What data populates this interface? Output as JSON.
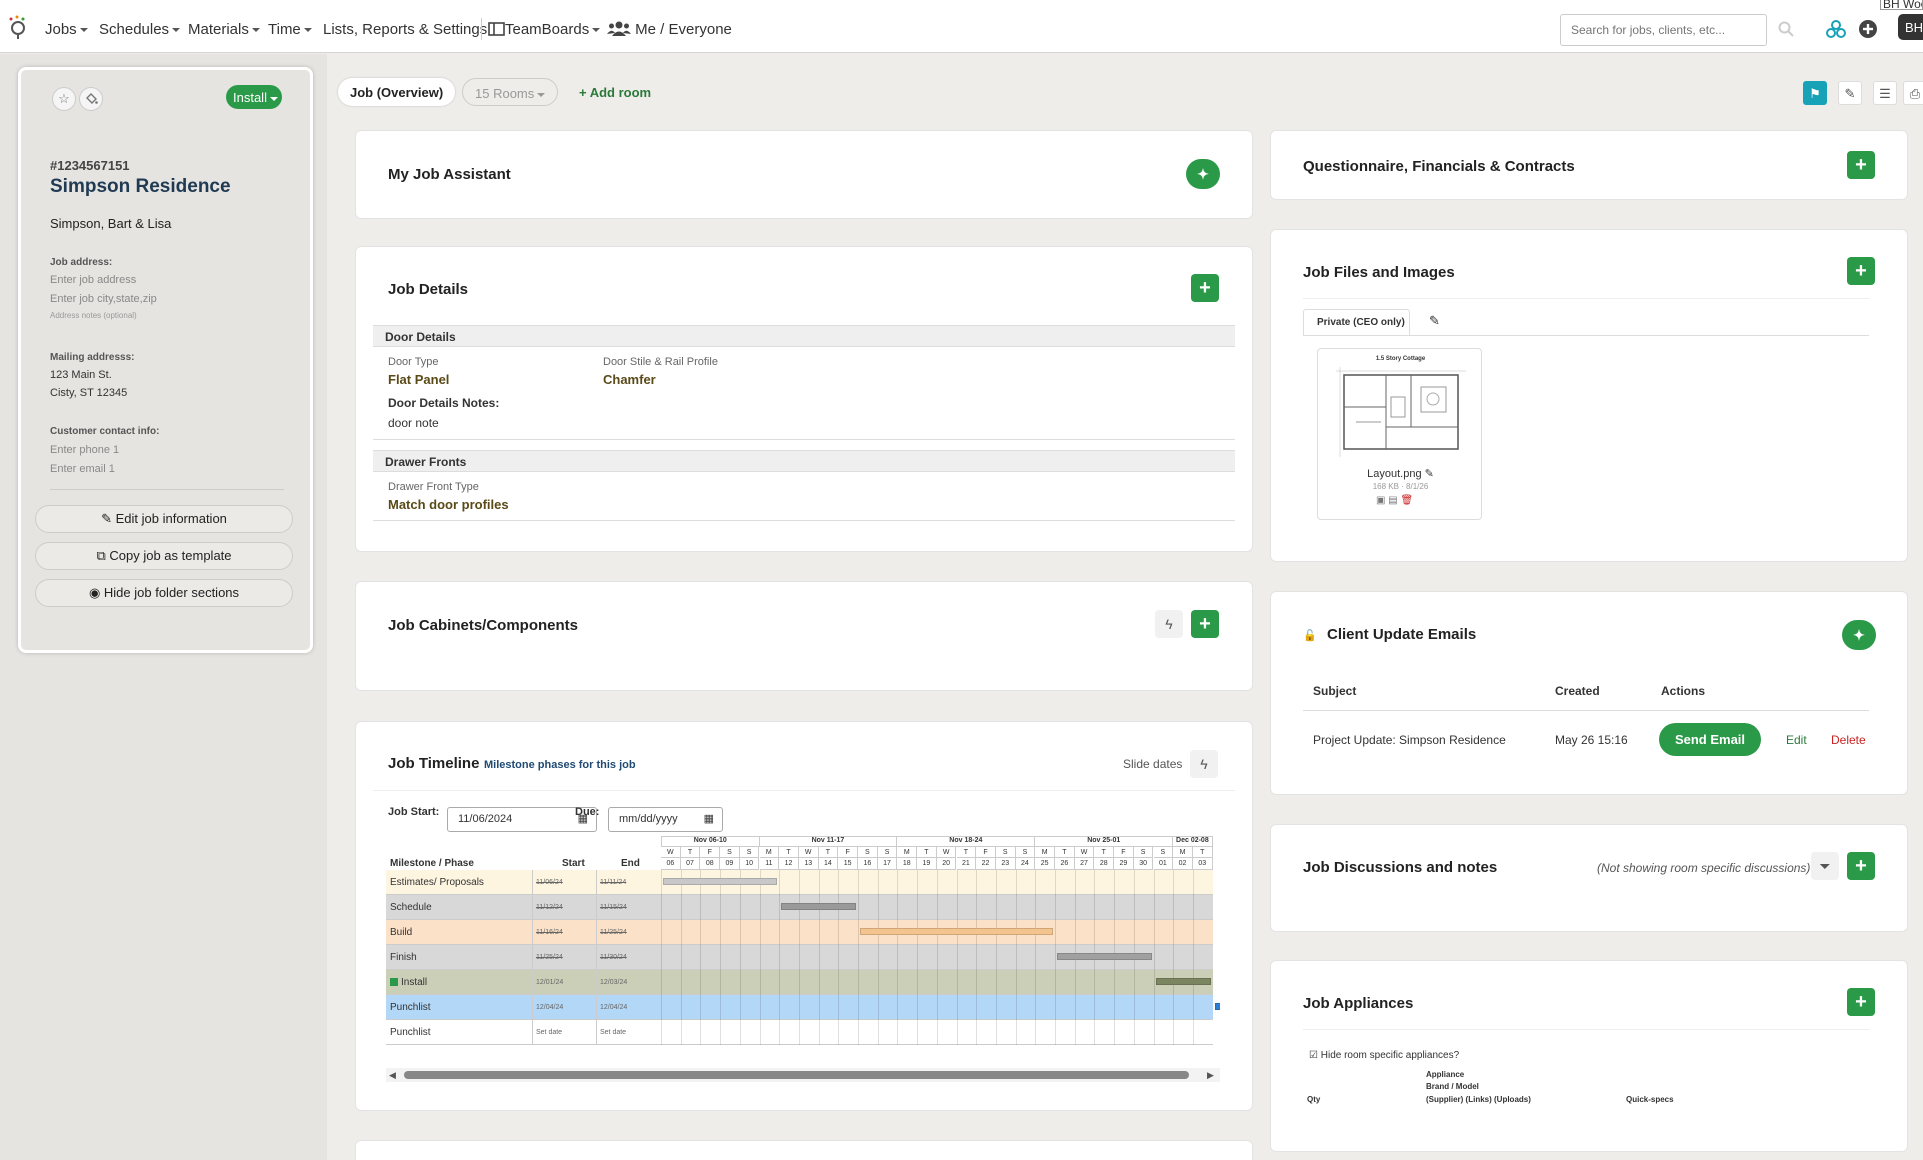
{
  "nav": {
    "items": [
      "Jobs",
      "Schedules",
      "Materials",
      "Time",
      "Lists, Reports & Settings",
      "TeamBoards",
      "Me / Everyone"
    ],
    "search_placeholder": "Search for jobs, clients, etc...",
    "user_name": "BH Woodwo",
    "avatar": "BH"
  },
  "left": {
    "status_button": "Install",
    "job_number": "#1234567151",
    "job_name": "Simpson Residence",
    "client": "Simpson, Bart & Lisa",
    "job_address_label": "Job address:",
    "job_address_ph": "Enter job address",
    "job_city_ph": "Enter job city,state,zip",
    "address_notes_ph": "Address notes (optional)",
    "mailing_label": "Mailing addresss:",
    "mailing_line1": "123 Main St.",
    "mailing_line2": "Cisty, ST 12345",
    "contact_label": "Customer contact info:",
    "phone_ph": "Enter phone 1",
    "email_ph": "Enter email 1",
    "buttons": [
      "Edit job information",
      "Copy job as template",
      "Hide job folder sections"
    ]
  },
  "tabs": {
    "overview": "Job (Overview)",
    "rooms": "15 Rooms",
    "add_room": "+ Add room"
  },
  "assistant": {
    "title": "My Job Assistant"
  },
  "details": {
    "title": "Job Details",
    "door_section": "Door Details",
    "door_type_label": "Door Type",
    "door_type_value": "Flat Panel",
    "door_stile_label": "Door Stile & Rail Profile",
    "door_stile_value": "Chamfer",
    "door_notes_label": "Door Details Notes:",
    "door_notes_value": "door note",
    "drawer_section": "Drawer Fronts",
    "drawer_type_label": "Drawer Front Type",
    "drawer_type_value": "Match door profiles"
  },
  "cabinets": {
    "title": "Job Cabinets/Components"
  },
  "timeline": {
    "title": "Job Timeline",
    "subtitle": "Milestone phases for this job",
    "slide_dates": "Slide dates",
    "start_label": "Job Start:",
    "start_value": "11/06/2024",
    "due_label": "Due:",
    "due_value": "mm/dd/yyyy",
    "col_milestone": "Milestone / Phase",
    "col_start": "Start",
    "col_end": "End",
    "weeks": [
      "Nov 06-10",
      "Nov 11-17",
      "Nov 18-24",
      "Nov 25-01",
      "Dec 02-08"
    ],
    "day_letters": [
      "W",
      "T",
      "F",
      "S",
      "S",
      "M",
      "T",
      "W",
      "T",
      "F",
      "S",
      "S",
      "M",
      "T",
      "W",
      "T",
      "F",
      "S",
      "S",
      "M",
      "T",
      "W",
      "T",
      "F",
      "S",
      "S",
      "M",
      "T"
    ],
    "day_numbers": [
      "06",
      "07",
      "08",
      "09",
      "10",
      "11",
      "12",
      "13",
      "14",
      "15",
      "16",
      "17",
      "18",
      "19",
      "20",
      "21",
      "22",
      "23",
      "24",
      "25",
      "26",
      "27",
      "28",
      "29",
      "30",
      "01",
      "02",
      "03"
    ],
    "rows": [
      {
        "name": "Estimates/ Proposals",
        "start": "11/06/24",
        "end": "11/11/24",
        "bg": "#fdf5e0",
        "bar": "#c8c8c8",
        "from": 0,
        "to": 6,
        "struck": true
      },
      {
        "name": "Schedule",
        "start": "11/12/24",
        "end": "11/15/24",
        "bg": "#d8d8d8",
        "bar": "#9a9a9a",
        "from": 6,
        "to": 10,
        "struck": true
      },
      {
        "name": "Build",
        "start": "11/16/24",
        "end": "11/25/24",
        "bg": "#fbe1c8",
        "bar": "#f4c48e",
        "from": 10,
        "to": 20,
        "struck": true
      },
      {
        "name": "Finish",
        "start": "11/25/24",
        "end": "11/30/24",
        "bg": "#d8d8d8",
        "bar": "#a0a0a0",
        "from": 20,
        "to": 25,
        "struck": true
      },
      {
        "name": "Install",
        "start": "12/01/24",
        "end": "12/03/24",
        "bg": "#cbcfb8",
        "bar": "#7b8560",
        "from": 25,
        "to": 28,
        "struck": false
      },
      {
        "name": "Punchlist",
        "start": "12/04/24",
        "end": "12/04/24",
        "bg": "#b3d7f7",
        "bar": "#2a7fd4",
        "from": 28,
        "to": 29,
        "struck": false
      },
      {
        "name": "Punchlist",
        "start": "Set date",
        "end": "Set date",
        "bg": "#ffffff",
        "bar": "",
        "from": 0,
        "to": 0,
        "struck": false
      }
    ]
  },
  "questionnaire": {
    "title": "Questionnaire, Financials & Contracts"
  },
  "files": {
    "title": "Job Files and Images",
    "tab": "Private (CEO only)",
    "thumb_title": "1.5 Story Cottage",
    "file_name": "Layout.png",
    "file_meta": "168 KB · 8/1/26"
  },
  "emails": {
    "title": "Client Update Emails",
    "col_subject": "Subject",
    "col_created": "Created",
    "col_actions": "Actions",
    "row_subject": "Project Update: Simpson Residence",
    "row_created": "May 26 15:16",
    "send": "Send Email",
    "edit": "Edit",
    "delete": "Delete"
  },
  "discussions": {
    "title": "Job Discussions and notes",
    "note": "(Not showing room specific discussions)"
  },
  "appliances": {
    "title": "Job Appliances",
    "hide_check": "Hide room specific appliances?",
    "col_qty": "Qty",
    "col_appliance": "Appliance",
    "col_brand": "Brand / Model",
    "col_links": "(Supplier) (Links) (Uploads)",
    "col_specs": "Quick-specs"
  },
  "colors": {
    "green": "#2b9a48",
    "red": "#cc2222",
    "olive": "#5a4a18"
  }
}
